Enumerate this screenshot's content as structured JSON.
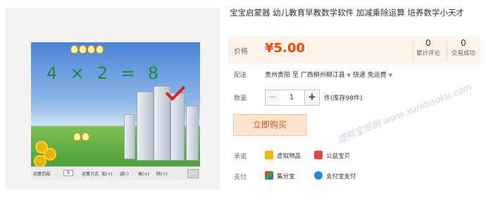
{
  "product": {
    "title": "宝宝启蒙器 幼儿教育早教数学软件 加减乘除运算 培养数学小天才"
  },
  "game": {
    "equation": "4  ×  2  =  8",
    "bar": {
      "range_label": "运算范围",
      "range_value": "9",
      "mode_label": "运算方式",
      "options": [
        "加(+)",
        "减(-)",
        "乘(×)",
        "除(÷)"
      ]
    }
  },
  "price": {
    "label": "价格",
    "value": "¥5.00"
  },
  "stats": {
    "reviews_count": "0",
    "reviews_label": "累计评论",
    "sales_count": "0",
    "sales_label": "交易成功"
  },
  "shipping": {
    "label": "配送",
    "from": "贵州贵阳 至",
    "to": "广西柳州柳江县",
    "method": "快递 免运费"
  },
  "quantity": {
    "label": "数量",
    "minus": "−",
    "value": "1",
    "plus": "+",
    "stock": "件(库存98件)"
  },
  "buy_button": "立即购买",
  "promise": {
    "label": "承诺",
    "items": [
      "虚拟物品",
      "公益宝贝"
    ]
  },
  "payment": {
    "label": "支付",
    "items": [
      "集分宝",
      "支付宝支付"
    ]
  },
  "watermark": "虚拟宝库网 www.xunibaoku.com",
  "colors": {
    "price": "#ff4400",
    "price_bg": "#fff2e8",
    "buy_bg": "#ffe4cf",
    "buy_text": "#e5511d"
  }
}
